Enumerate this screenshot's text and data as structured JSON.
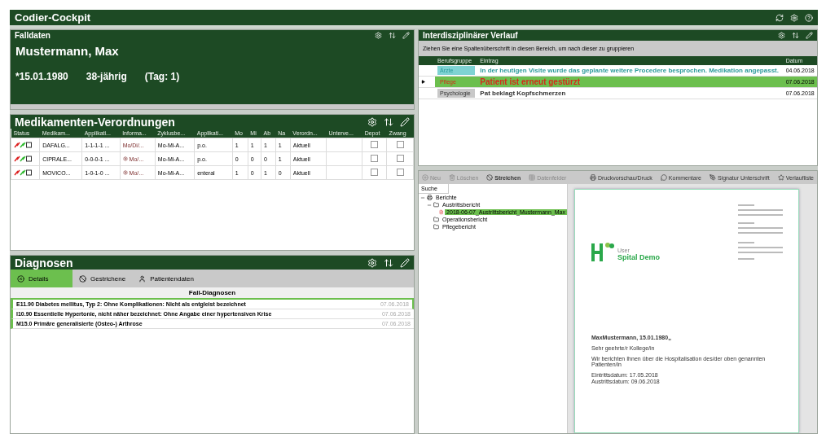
{
  "app": {
    "title": "Codier-Cockpit"
  },
  "falldaten": {
    "title": "Falldaten",
    "patient": "Mustermann, Max",
    "birth": "*15.01.1980",
    "age": "38-jährig",
    "day": "(Tag: 1)"
  },
  "medikamente": {
    "title": "Medikamenten-Verordnungen",
    "columns": [
      "Status",
      "Medikam...",
      "Applikati...",
      "Informa...",
      "Zyklusbe...",
      "Applikati...",
      "Mo",
      "Mi",
      "Ab",
      "Na",
      "Verordn...",
      "Unterve...",
      "Depot",
      "Zwang"
    ],
    "rows": [
      {
        "name": "DAFALG...",
        "schema": "1-1-1-1 ...",
        "info": "Mo/Di/...",
        "info_icon": false,
        "cycle": "Mo-Mi-A...",
        "route": "p.o.",
        "mo": "1",
        "mi": "1",
        "ab": "1",
        "na": "1",
        "status": "Aktuell",
        "depot": false,
        "zwang": false
      },
      {
        "name": "CIPRALE...",
        "schema": "0-0-0-1 ...",
        "info": "Mo/...",
        "info_icon": true,
        "cycle": "Mo-Mi-A...",
        "route": "p.o.",
        "mo": "0",
        "mi": "0",
        "ab": "0",
        "na": "1",
        "status": "Aktuell",
        "depot": false,
        "zwang": false
      },
      {
        "name": "MOVICO...",
        "schema": "1-0-1-0 ...",
        "info": "Mo/...",
        "info_icon": true,
        "cycle": "Mo-Mi-A...",
        "route": "enteral",
        "mo": "1",
        "mi": "0",
        "ab": "1",
        "na": "0",
        "status": "Aktuell",
        "depot": false,
        "zwang": false
      }
    ]
  },
  "diagnosen": {
    "title": "Diagnosen",
    "tabs": [
      {
        "label": "Details",
        "kind": "details",
        "selected": true
      },
      {
        "label": "Gestrichene",
        "kind": "struck",
        "selected": false
      },
      {
        "label": "Patientendaten",
        "kind": "patient",
        "selected": false
      }
    ],
    "group": "Fall-Diagnosen",
    "rows": [
      {
        "text": "E11.90 Diabetes mellitus, Typ 2: Ohne Komplikationen: Nicht als entgleist bezeichnet",
        "date": "07.06.2018",
        "selected": true
      },
      {
        "text": "I10.90 Essentielle Hypertonie, nicht näher bezeichnet: Ohne Angabe einer hypertensiven Krise",
        "date": "07.06.2018",
        "selected": false
      },
      {
        "text": "M15.0 Primäre generalisierte (Osteo-) Arthrose",
        "date": "07.06.2018",
        "selected": false
      }
    ]
  },
  "verlauf": {
    "title": "Interdisziplinärer Verlauf",
    "group_hint": "Ziehen Sie eine Spaltenüberschrift in diesen Bereich, um nach dieser zu gruppieren",
    "columns": [
      "Berufsgruppe",
      "Eintrag",
      "Datum"
    ],
    "rows": [
      {
        "group": "Ärzte",
        "color": "#7fd3d3",
        "text": "In der heutigen Visite wurde das geplante weitere Procedere besprochen. Medikation angepasst.",
        "date": "04.06.2018",
        "selected": false,
        "kind": "arzt"
      },
      {
        "group": "Pflege",
        "color": "#6cbf4e",
        "text": "Patient ist erneut gestürzt",
        "date": "07.06.2018",
        "selected": true,
        "kind": "pflege"
      },
      {
        "group": "Psychologie",
        "color": "#c8c8c8",
        "text": "Pat beklagt Kopfschmerzen",
        "date": "07.06.2018",
        "selected": false,
        "kind": "psych"
      }
    ]
  },
  "berichte": {
    "toolbar_left": [
      {
        "label": "Neu",
        "kind": "new",
        "disabled": true
      },
      {
        "label": "Löschen",
        "kind": "delete",
        "disabled": true
      },
      {
        "label": "Streichen",
        "kind": "strike",
        "disabled": false
      },
      {
        "label": "Datenfelder",
        "kind": "fields",
        "disabled": true
      }
    ],
    "toolbar_right": [
      {
        "label": "Druckvorschau/Druck",
        "kind": "print"
      },
      {
        "label": "Kommentare",
        "kind": "comment"
      },
      {
        "label": "Signatur Unterschrift",
        "kind": "sign"
      },
      {
        "label": "Verlaufliste",
        "kind": "star"
      }
    ],
    "search_tab": "Suche",
    "tree": [
      {
        "label": "Berichte",
        "kind": "root",
        "selected": false,
        "expanded": true,
        "children": [
          {
            "label": "Austrittsbericht",
            "kind": "folder",
            "selected": false,
            "expanded": true,
            "children": [
              {
                "label": "2018-06-07_Austrittsbericht_Mustermann_Max",
                "kind": "file",
                "selected": true
              }
            ]
          },
          {
            "label": "Operationsbericht",
            "kind": "folder",
            "selected": false
          },
          {
            "label": "Pflegebericht",
            "kind": "folder",
            "selected": false
          }
        ]
      }
    ],
    "letter": {
      "logo": "Spital Demo",
      "logo_small": "User",
      "salutation_name": "MaxMustermann, 15.01.1980,,",
      "greeting": "Sehr geehrte/r Kollege/in",
      "body": "Wir berichten Ihnen über die Hospitalisation des/der oben genannten Patienten/in",
      "entry": "Eintrittsdatum: 17.05.2018",
      "exit": "Austrittsdatum: 09.06.2018"
    }
  }
}
